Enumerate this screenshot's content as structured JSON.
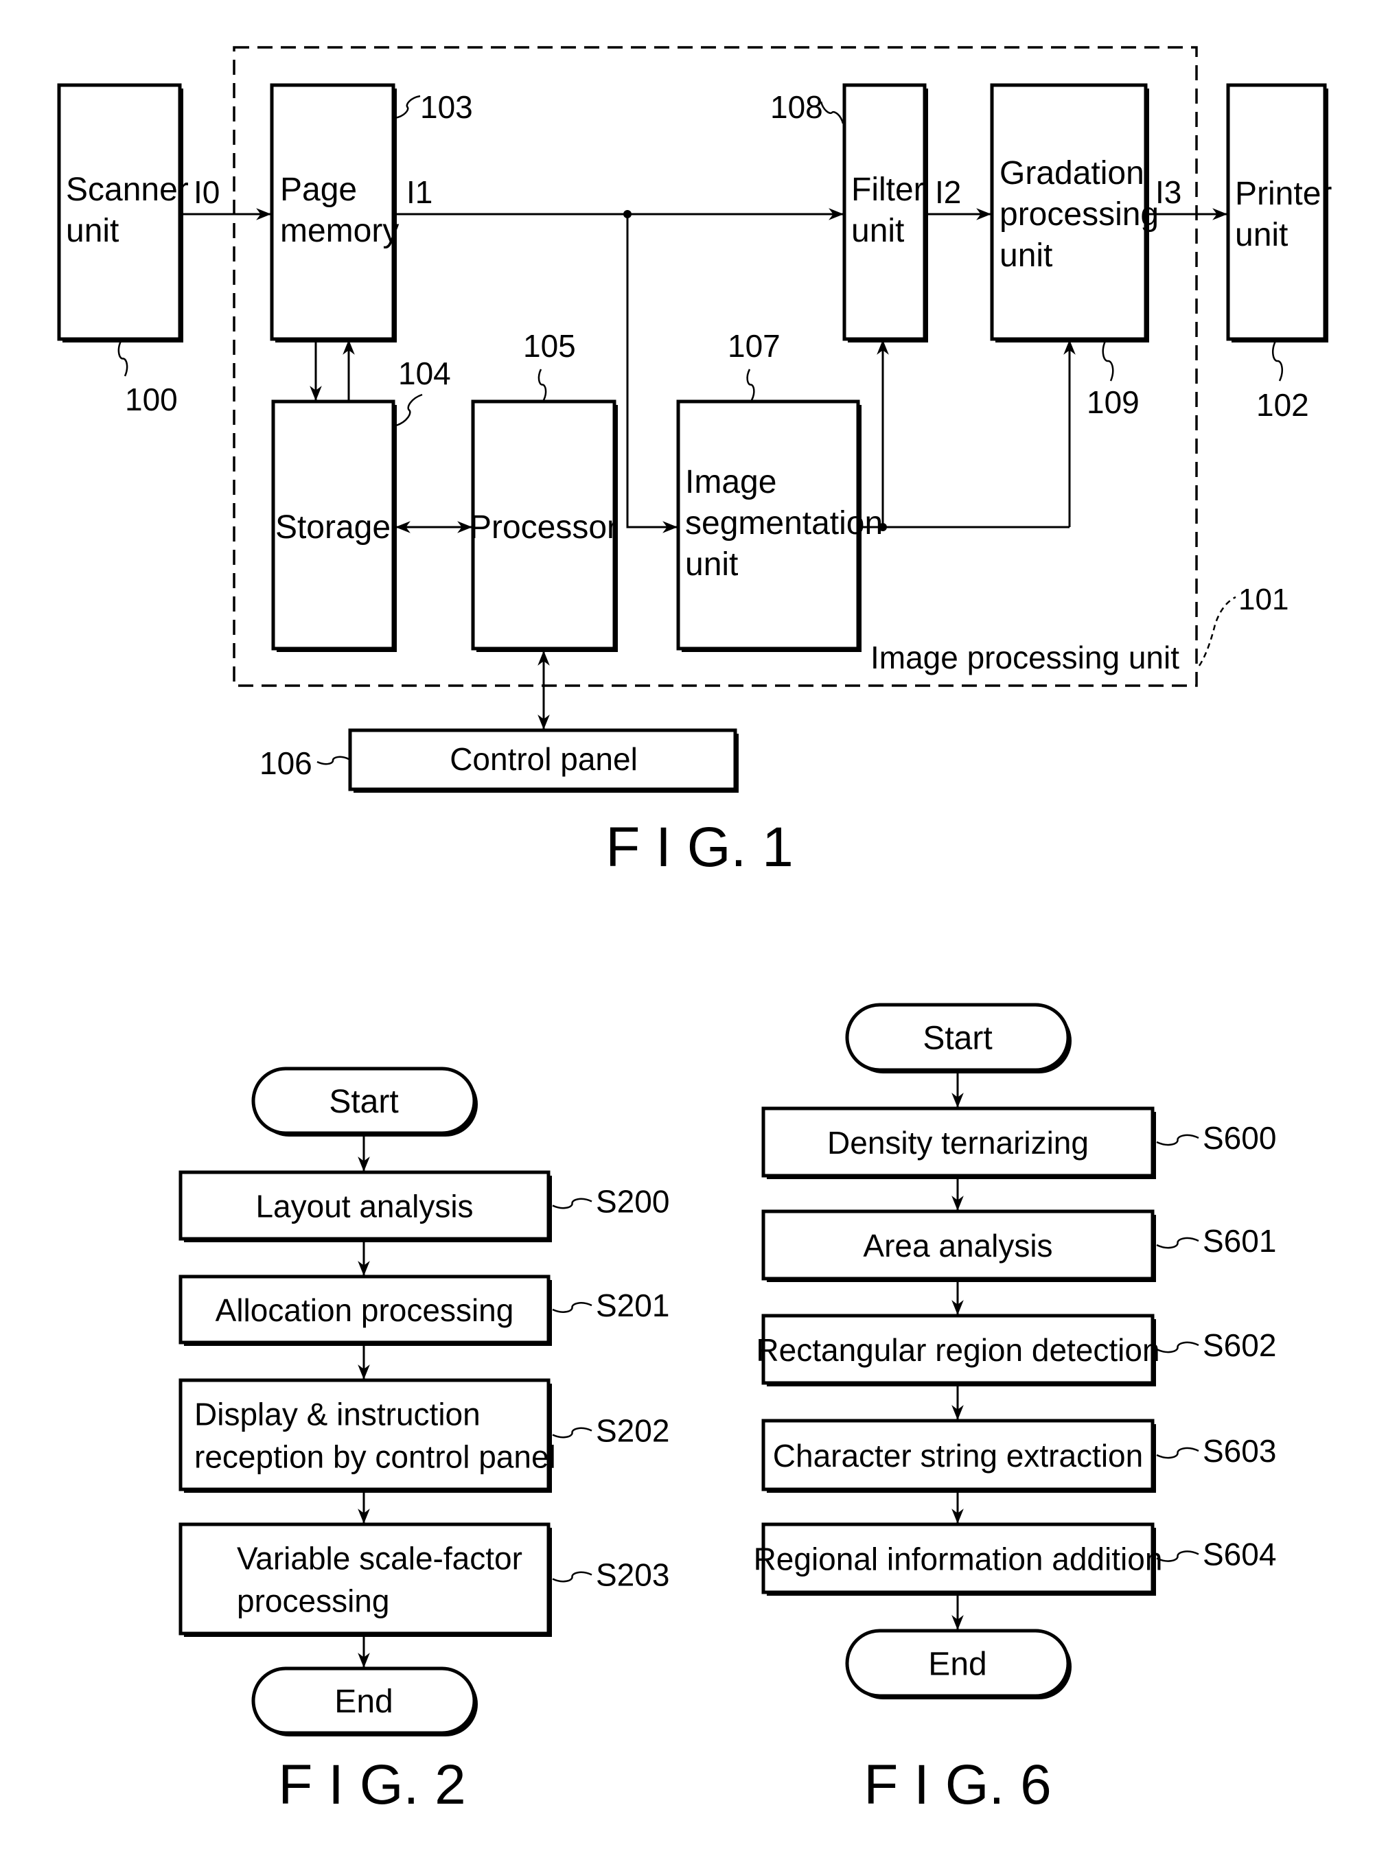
{
  "fig1": {
    "caption": "F I G. 1",
    "boundary_label": "Image processing unit",
    "boundary_ref": "101",
    "blocks": {
      "scanner": {
        "lines": [
          "Scanner",
          "unit"
        ],
        "ref": "100"
      },
      "page_memory": {
        "lines": [
          "Page",
          "memory"
        ],
        "ref": "103"
      },
      "filter": {
        "lines": [
          "Filter",
          "unit"
        ],
        "ref": "108"
      },
      "gradation": {
        "lines": [
          "Gradation",
          "processing",
          "unit"
        ],
        "ref": "109"
      },
      "printer": {
        "lines": [
          "Printer",
          "unit"
        ],
        "ref": "102"
      },
      "storage": {
        "lines": [
          "Storage"
        ],
        "ref": "104"
      },
      "processor": {
        "lines": [
          "Processor"
        ],
        "ref": "105"
      },
      "segmentation": {
        "lines": [
          "Image",
          "segmentation",
          "unit"
        ],
        "ref": "107"
      },
      "control_panel": {
        "lines": [
          "Control  panel"
        ],
        "ref": "106"
      }
    },
    "signals": {
      "i0": "I0",
      "i1": "I1",
      "i2": "I2",
      "i3": "I3"
    }
  },
  "fig2": {
    "caption": "F I G. 2",
    "start": "Start",
    "end": "End",
    "steps": [
      {
        "lines": [
          "Layout  analysis"
        ],
        "ref": "S200"
      },
      {
        "lines": [
          "Allocation  processing"
        ],
        "ref": "S201"
      },
      {
        "lines": [
          "Display &  instruction",
          "reception  by  control panel"
        ],
        "ref": "S202"
      },
      {
        "lines": [
          "Variable scale-factor",
          "processing"
        ],
        "ref": "S203"
      }
    ]
  },
  "fig6": {
    "caption": "F I G. 6",
    "start": "Start",
    "end": "End",
    "steps": [
      {
        "lines": [
          "Density  ternarizing"
        ],
        "ref": "S600"
      },
      {
        "lines": [
          "Area  analysis"
        ],
        "ref": "S601"
      },
      {
        "lines": [
          "Rectangular  region  detection"
        ],
        "ref": "S602"
      },
      {
        "lines": [
          "Character  string  extraction"
        ],
        "ref": "S603"
      },
      {
        "lines": [
          "Regional  information  addition"
        ],
        "ref": "S604"
      }
    ]
  }
}
